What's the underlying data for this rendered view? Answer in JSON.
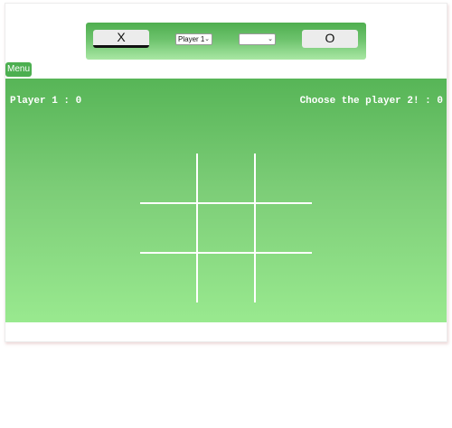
{
  "topbar": {
    "x_button_label": "X",
    "o_button_label": "O",
    "player1_select": {
      "selected": "Player 1"
    },
    "player2_select": {
      "selected": ""
    }
  },
  "menu": {
    "label": "Menu"
  },
  "scoreboard": {
    "player1": {
      "name": "Player 1",
      "score": "0",
      "text": "Player 1 : 0"
    },
    "player2": {
      "name": "Choose the player 2!",
      "score": "0",
      "text": "Choose the player 2! : 0"
    }
  },
  "board": {
    "cells": [
      "",
      "",
      "",
      "",
      "",
      "",
      "",
      "",
      ""
    ]
  },
  "colors": {
    "board_top": "#57b557",
    "board_bottom": "#99e98f",
    "menu_button": "#4caf50",
    "grid_lines": "#ffffff"
  }
}
